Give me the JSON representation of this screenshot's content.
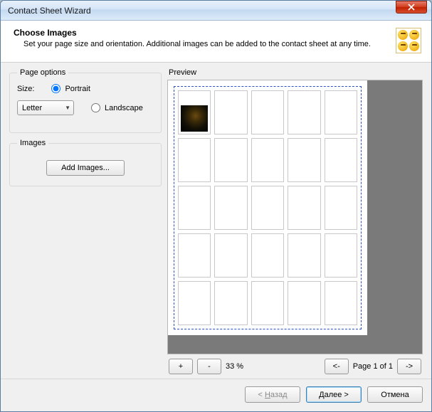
{
  "window": {
    "title": "Contact Sheet Wizard"
  },
  "header": {
    "title": "Choose Images",
    "subtitle": "Set your page size and orientation. Additional images can be added to the contact sheet at any time."
  },
  "page_options": {
    "legend": "Page options",
    "size_label": "Size:",
    "size_value": "Letter",
    "orientation": "portrait",
    "portrait_label": "Portrait",
    "landscape_label": "Landscape"
  },
  "images_group": {
    "legend": "Images",
    "add_button": "Add Images..."
  },
  "preview": {
    "label": "Preview",
    "grid": {
      "rows": 5,
      "cols": 5,
      "filled_count": 1
    },
    "zoom_in": "+",
    "zoom_out": "-",
    "zoom_text": "33 %",
    "prev_page": "<-",
    "next_page": "->",
    "page_status": "Page 1 of 1"
  },
  "footer": {
    "back": "< Назад",
    "next": "Далее >",
    "cancel": "Отмена"
  }
}
